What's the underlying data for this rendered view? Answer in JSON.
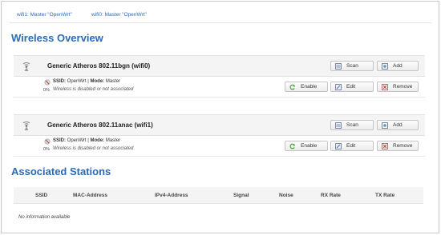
{
  "tabs": [
    {
      "label": "wifi1: Master \"OpenWrt\""
    },
    {
      "label": "wifi0: Master \"OpenWrt\""
    }
  ],
  "overview": {
    "title": "Wireless Overview",
    "devices": [
      {
        "title": "Generic Atheros 802.11bgn (wifi0)",
        "scan_label": "Scan",
        "add_label": "Add",
        "network": {
          "signal": "0%",
          "ssid_key": "SSID:",
          "ssid_value": " OpenWrt | ",
          "mode_key": "Mode:",
          "mode_value": " Master",
          "status": "Wireless is disabled or not associated",
          "enable_label": "Enable",
          "edit_label": "Edit",
          "remove_label": "Remove"
        }
      },
      {
        "title": "Generic Atheros 802.11anac (wifi1)",
        "scan_label": "Scan",
        "add_label": "Add",
        "network": {
          "signal": "0%",
          "ssid_key": "SSID:",
          "ssid_value": " OpenWrt | ",
          "mode_key": "Mode:",
          "mode_value": " Master",
          "status": "Wireless is disabled or not associated",
          "enable_label": "Enable",
          "edit_label": "Edit",
          "remove_label": "Remove"
        }
      }
    ]
  },
  "stations": {
    "title": "Associated Stations",
    "columns": [
      "SSID",
      "MAC-Address",
      "IPv4-Address",
      "Signal",
      "Noise",
      "RX Rate",
      "TX Rate"
    ],
    "empty_text": "No information available"
  },
  "colors": {
    "accent": "#2a6bb8",
    "enable_icon": "#3a9a2a",
    "remove_icon": "#c0392b"
  },
  "icons": {
    "device": "wireless-radio-icon",
    "signal": "signal-strength-icon",
    "scan": "scan-icon",
    "add": "add-icon",
    "enable": "enable-refresh-icon",
    "edit": "edit-icon",
    "remove": "remove-icon"
  }
}
